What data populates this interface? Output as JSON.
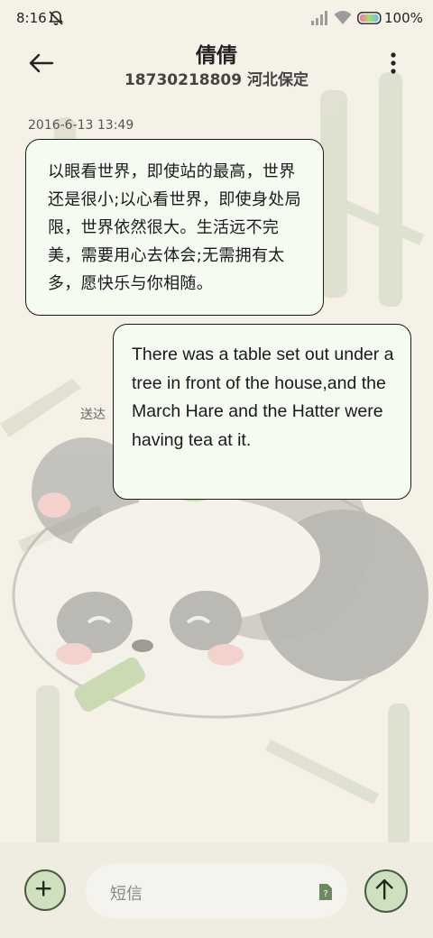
{
  "status_bar": {
    "time": "8:16",
    "battery": "100%"
  },
  "header": {
    "name": "倩倩",
    "number_location": "18730218809 河北保定"
  },
  "conversation": {
    "timestamp": "2016-6-13 13:49",
    "messages": [
      {
        "direction": "incoming",
        "text": "以眼看世界，即使站的最高，世界还是很小;以心看世界，即使身处局限，世界依然很大。生活远不完美，需要用心去体会;无需拥有太多，愿快乐与你相随。"
      },
      {
        "direction": "outgoing",
        "text": "There was a table set out under a tree in front of the house,and the March Hare and the Hatter were having tea at it.",
        "status": "送达"
      }
    ]
  },
  "composer": {
    "placeholder": "短信"
  },
  "icons": {
    "back": "arrow-left-icon",
    "more": "more-vertical-icon",
    "add": "plus-icon",
    "send": "arrow-up-icon",
    "mute": "bell-off-icon",
    "signal": "signal-icon",
    "wifi": "wifi-icon",
    "battery": "battery-icon",
    "sms": "sms-icon"
  },
  "colors": {
    "background": "#f5f1e6",
    "bubble": "#f6fbf1",
    "button_fill": "#cfe0bf",
    "button_border": "#4b5a43"
  }
}
